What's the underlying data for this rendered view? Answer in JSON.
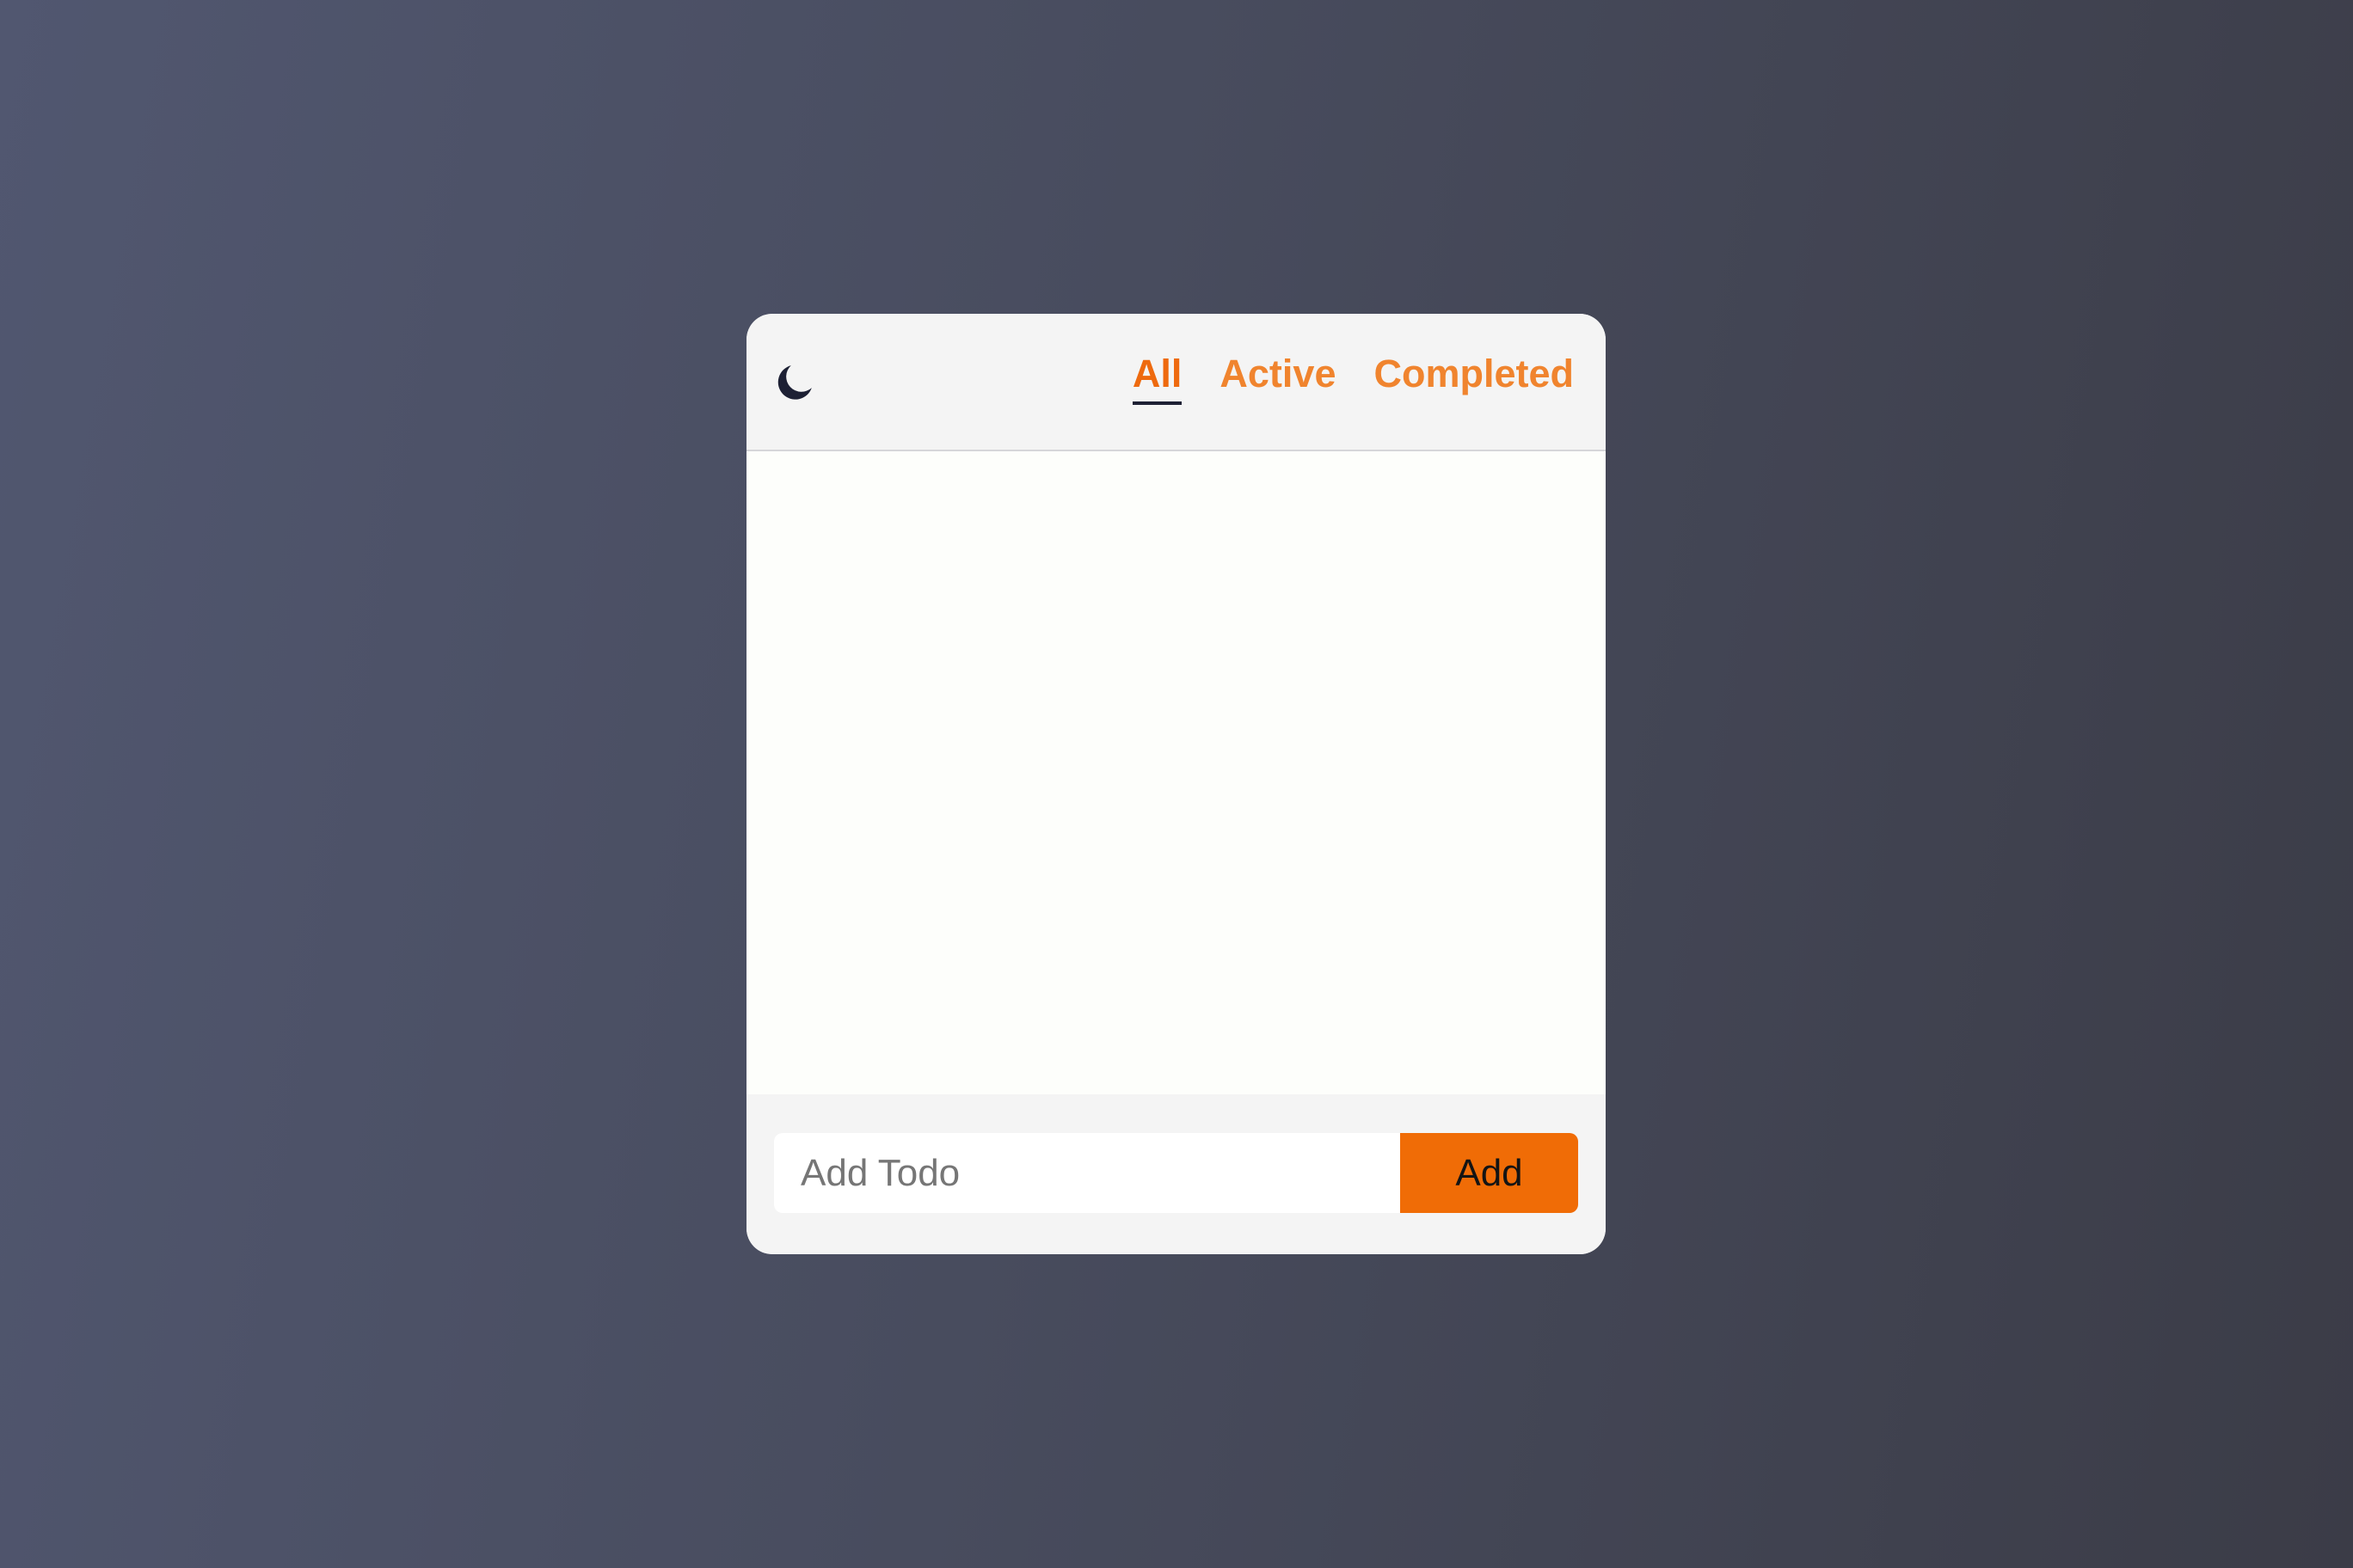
{
  "header": {
    "theme_toggle_icon": "moon-icon",
    "tabs": [
      {
        "label": "All",
        "active": true
      },
      {
        "label": "Active",
        "active": false
      },
      {
        "label": "Completed",
        "active": false
      }
    ]
  },
  "todos": [],
  "footer": {
    "input_placeholder": "Add Todo",
    "input_value": "",
    "add_label": "Add"
  },
  "colors": {
    "accent": "#f06c06",
    "tab_text": "#f0842e",
    "active_underline": "#1d2034",
    "card_background": "#f4f4f4",
    "list_background": "#fdfefb"
  }
}
